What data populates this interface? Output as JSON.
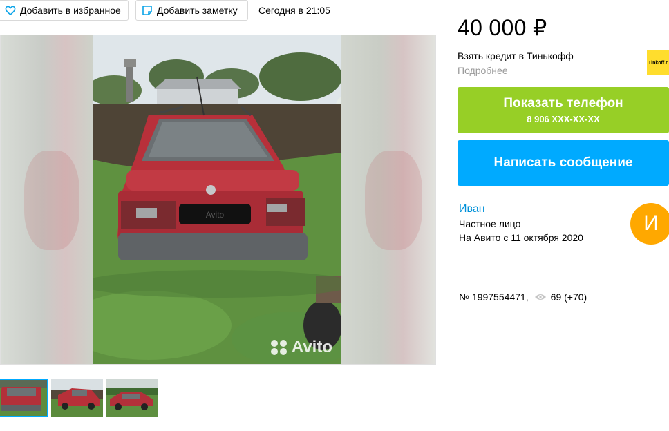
{
  "toolbar": {
    "favorite_label": "Добавить в избранное",
    "note_label": "Добавить заметку",
    "date": "Сегодня в 21:05"
  },
  "gallery": {
    "watermark": "Avito",
    "plate_text": "Avito",
    "thumbnails": 3,
    "active_thumbnail": 1
  },
  "listing": {
    "price": "40 000 ₽",
    "credit_text": "Взять кредит в Тинькофф",
    "credit_more": "Подробнее",
    "bank_logo_text": "Tinkoff.r",
    "phone_button": "Показать телефон",
    "phone_number": "8 906 XXX-XX-XX",
    "message_button": "Написать сообщение"
  },
  "seller": {
    "name": "Иван",
    "type": "Частное лицо",
    "since": "На Авито с 11 октября 2020",
    "avatar_letter": "И"
  },
  "meta": {
    "ad_number": "№ 1997554471,",
    "views": "69 (+70)"
  },
  "colors": {
    "phone_button": "#97cf26",
    "message_button": "#00aaff",
    "link": "#0091d9",
    "avatar": "#ffa800",
    "bank_logo": "#ffdd2d"
  },
  "icons": [
    "heart-icon",
    "note-icon",
    "eye-icon"
  ]
}
